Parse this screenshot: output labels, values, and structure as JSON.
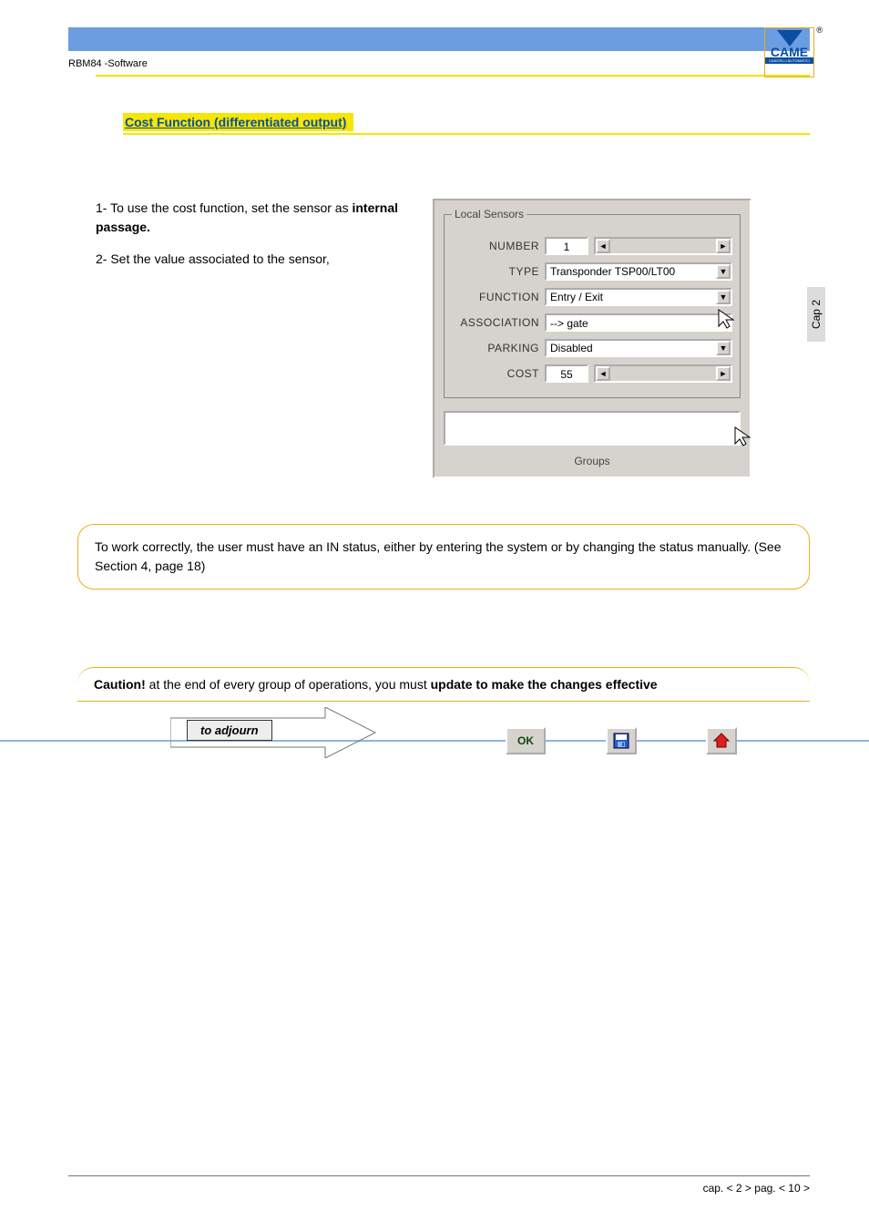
{
  "header": {
    "doc_title": "RBM84 -Software",
    "logo_text": "CAME",
    "logo_sub": "CANCELLI AUTOMATICI"
  },
  "section": {
    "title": "Cost  Function (differentiated output)"
  },
  "instructions": {
    "line1_a": "1- To use the cost function, set the sensor as ",
    "line1_b": "internal passage.",
    "line2": "2- Set the value associated to the sensor,"
  },
  "dialog": {
    "legend": "Local Sensors",
    "labels": {
      "number": "NUMBER",
      "type": "TYPE",
      "function": "FUNCTION",
      "association": "ASSOCIATION",
      "parking": "PARKING",
      "cost": "COST"
    },
    "values": {
      "number": "1",
      "type": "Transponder  TSP00/LT00",
      "function": "Entry / Exit",
      "association": "--> gate",
      "parking": "Disabled",
      "cost": "55"
    },
    "groups_label": "Groups"
  },
  "note": {
    "text": "To work correctly, the user must have an IN status, either by entering the system or by changing the status manually. (See Section 4, page 18)"
  },
  "caution": {
    "prefix": "Caution!",
    "mid": " at the end of every group of operations, you must ",
    "bold": "update to make the changes effective"
  },
  "actions": {
    "adjourn": "to adjourn",
    "ok": "OK"
  },
  "footer": {
    "text": "cap. < 2 > pag. < 10 >"
  },
  "side_tab": "Cap 2"
}
